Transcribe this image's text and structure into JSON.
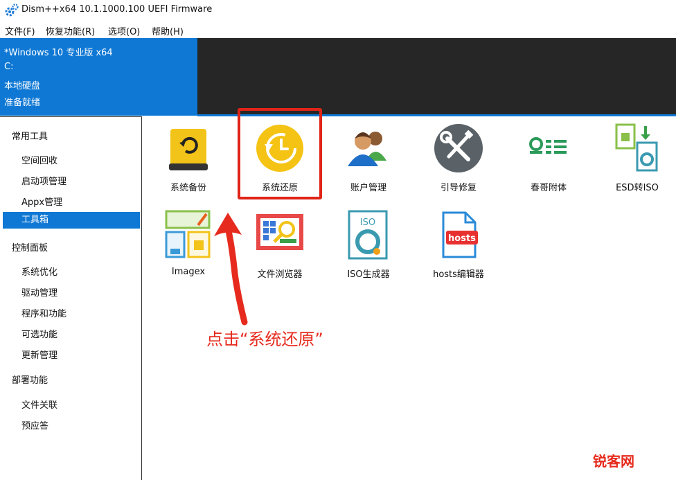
{
  "window": {
    "title": "Dism++x64 10.1.1000.100 UEFI Firmware"
  },
  "menu": [
    {
      "label": "文件(F)"
    },
    {
      "label": "恢复功能(R)"
    },
    {
      "label": "选项(O)"
    },
    {
      "label": "帮助(H)"
    }
  ],
  "info": {
    "os": "*Windows 10 专业版 x64",
    "drive": "C:",
    "disk": "本地硬盘",
    "status": "准备就绪"
  },
  "sidebar": {
    "groups": [
      {
        "title": "常用工具",
        "items": [
          "空间回收",
          "启动项管理",
          "Appx管理",
          "工具箱"
        ]
      },
      {
        "title": "控制面板",
        "items": [
          "系统优化",
          "驱动管理",
          "程序和功能",
          "可选功能",
          "更新管理"
        ]
      },
      {
        "title": "部署功能",
        "items": [
          "文件关联",
          "预应答"
        ]
      }
    ],
    "selected": "工具箱"
  },
  "tools": [
    {
      "label": "系统备份",
      "icon": "backup-drive-icon"
    },
    {
      "label": "系统还原",
      "icon": "restore-clock-icon"
    },
    {
      "label": "账户管理",
      "icon": "users-icon"
    },
    {
      "label": "引导修复",
      "icon": "wrench-screwdriver-icon"
    },
    {
      "label": "春哥附体",
      "icon": "admin-list-icon"
    },
    {
      "label": "ESD转ISO",
      "icon": "esd-to-iso-icon"
    },
    {
      "label": "Imagex",
      "icon": "imagex-icon"
    },
    {
      "label": "文件浏览器",
      "icon": "file-browser-icon"
    },
    {
      "label": "ISO生成器",
      "icon": "iso-disc-icon"
    },
    {
      "label": "hosts编辑器",
      "icon": "hosts-file-icon"
    }
  ],
  "annotation": {
    "text": "点击“系统还原”"
  },
  "watermark": {
    "text": "锐客网"
  },
  "colors": {
    "accent": "#0f78d4",
    "dark": "#262626",
    "highlight": "#e02418"
  }
}
